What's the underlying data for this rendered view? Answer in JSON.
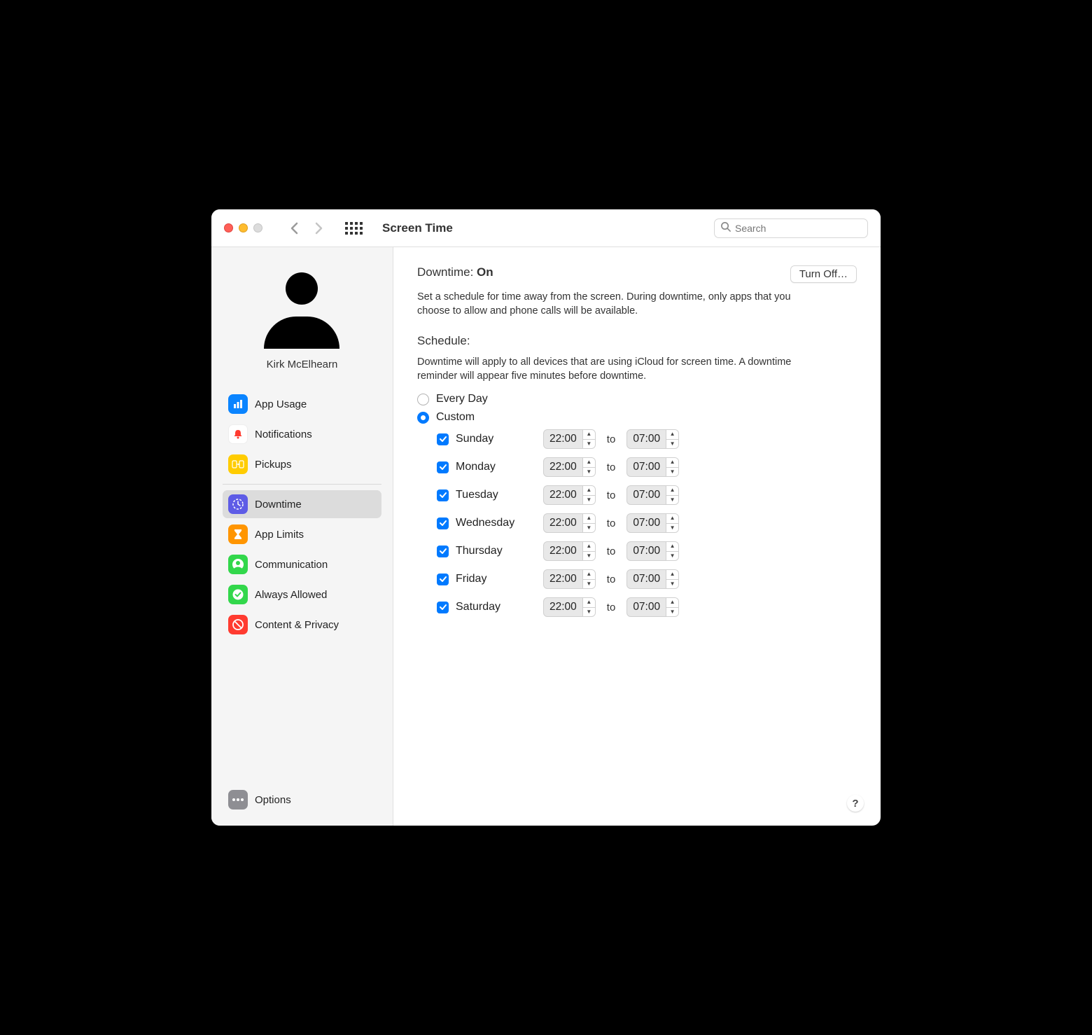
{
  "window": {
    "title": "Screen Time",
    "search_placeholder": "Search"
  },
  "profile": {
    "name": "Kirk McElhearn"
  },
  "sidebar": {
    "groups": [
      [
        {
          "icon": "bar-chart",
          "color": "#0a84ff",
          "label": "App Usage"
        },
        {
          "icon": "bell",
          "color": "#ffffff",
          "label": "Notifications"
        },
        {
          "icon": "pickup",
          "color": "#ffcc00",
          "label": "Pickups"
        }
      ],
      [
        {
          "icon": "downtime",
          "color": "#5e5ce6",
          "label": "Downtime",
          "selected": true
        },
        {
          "icon": "hourglass",
          "color": "#ff9500",
          "label": "App Limits"
        },
        {
          "icon": "person",
          "color": "#32d74b",
          "label": "Communication"
        },
        {
          "icon": "check-shield",
          "color": "#32d74b",
          "label": "Always Allowed"
        },
        {
          "icon": "no-entry",
          "color": "#ff3b30",
          "label": "Content & Privacy"
        }
      ]
    ],
    "options_label": "Options"
  },
  "main": {
    "downtime_label": "Downtime:",
    "downtime_status": "On",
    "turn_off_label": "Turn Off…",
    "description": "Set a schedule for time away from the screen. During downtime, only apps that you choose to allow and phone calls will be available.",
    "schedule_heading": "Schedule:",
    "schedule_description": "Downtime will apply to all devices that are using iCloud for screen time. A downtime reminder will appear five minutes before downtime.",
    "every_day_label": "Every Day",
    "custom_label": "Custom",
    "selected_mode": "custom",
    "to_label": "to",
    "days": [
      {
        "name": "Sunday",
        "enabled": true,
        "from": "22:00",
        "to": "07:00"
      },
      {
        "name": "Monday",
        "enabled": true,
        "from": "22:00",
        "to": "07:00"
      },
      {
        "name": "Tuesday",
        "enabled": true,
        "from": "22:00",
        "to": "07:00"
      },
      {
        "name": "Wednesday",
        "enabled": true,
        "from": "22:00",
        "to": "07:00"
      },
      {
        "name": "Thursday",
        "enabled": true,
        "from": "22:00",
        "to": "07:00"
      },
      {
        "name": "Friday",
        "enabled": true,
        "from": "22:00",
        "to": "07:00"
      },
      {
        "name": "Saturday",
        "enabled": true,
        "from": "22:00",
        "to": "07:00"
      }
    ],
    "help_label": "?"
  },
  "icons": {
    "bar-chart": "chart-bar-icon",
    "bell": "bell-icon",
    "pickup": "pickup-icon",
    "downtime": "clock-icon",
    "hourglass": "hourglass-icon",
    "person": "person-circle-icon",
    "check-shield": "checkmark-shield-icon",
    "no-entry": "no-entry-icon",
    "options": "ellipsis-icon"
  }
}
